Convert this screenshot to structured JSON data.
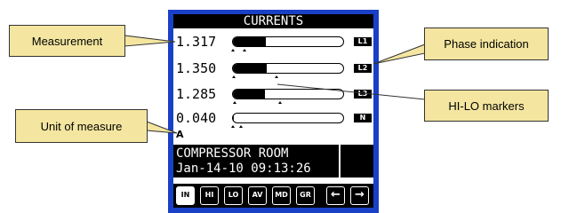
{
  "title": "CURRENTS",
  "rows": [
    {
      "value": "1.317",
      "phase": "L1",
      "fill": 0.3
    },
    {
      "value": "1.350",
      "phase": "L2",
      "fill": 0.31
    },
    {
      "value": "1.285",
      "phase": "L3",
      "fill": 0.29
    },
    {
      "value": "0.040",
      "phase": "N",
      "fill": 0.01
    }
  ],
  "unit": "A",
  "info": {
    "line1": "COMPRESSOR ROOM",
    "line2": "Jan-14-10 09:13:26"
  },
  "buttons": [
    "IN",
    "HI",
    "LO",
    "AV",
    "MD",
    "GR",
    "←",
    "→"
  ],
  "callouts": {
    "measurement": "Measurement",
    "phase": "Phase indication",
    "markers": "HI-LO markers",
    "unit": "Unit of measure"
  },
  "colors": {
    "frame": "#1a40c8",
    "callout": "#f4e6a0"
  }
}
